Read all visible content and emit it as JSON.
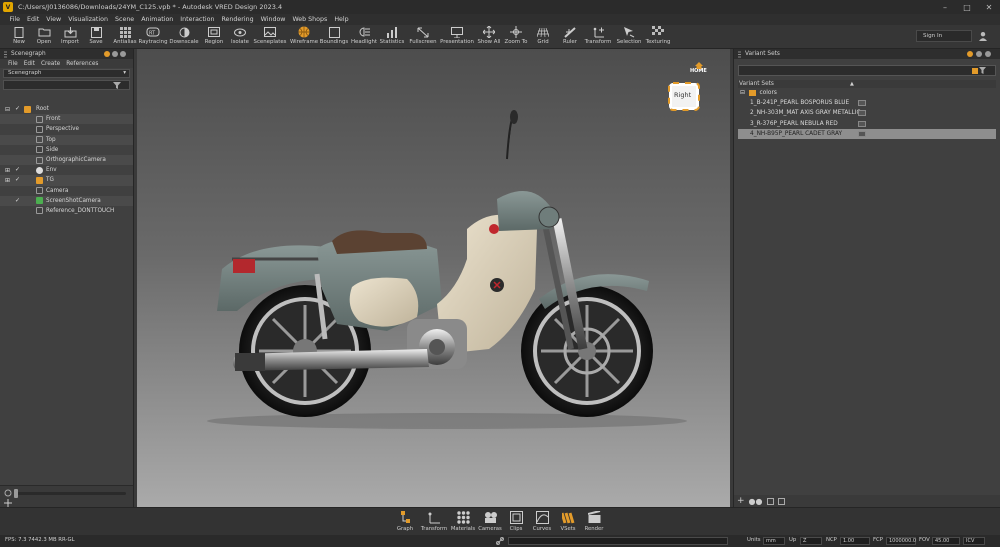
{
  "window": {
    "title": "C:/Users/J0136086/Downloads/24YM_C125.vpb * - Autodesk VRED Design 2023.4",
    "app_icon_letter": "V"
  },
  "menubar": [
    "File",
    "Edit",
    "View",
    "Visualization",
    "Scene",
    "Animation",
    "Interaction",
    "Rendering",
    "Window",
    "Web Shops",
    "Help"
  ],
  "toolbar": {
    "tools": [
      "New",
      "Open",
      "Import",
      "Save",
      "Antialias",
      "Raytracing",
      "Downscale",
      "Region",
      "Isolate",
      "Sceneplates",
      "Wireframe",
      "Boundings",
      "Headlight",
      "Statistics",
      "Fullscreen",
      "Presentation",
      "Show All",
      "Zoom To",
      "Grid",
      "Ruler",
      "Transform",
      "Selection",
      "Texturing"
    ],
    "signin": "Sign In"
  },
  "scenegraph": {
    "panel_title": "Scenegraph",
    "menu": [
      "File",
      "Edit",
      "Create",
      "References"
    ],
    "dropdown": "Scenegraph",
    "items": [
      "Root",
      "Front",
      "Perspective",
      "Top",
      "Side",
      "OrthographicCamera",
      "Env",
      "TG",
      "Camera",
      "ScreenShotCamera",
      "Reference_DONTTOUCH"
    ]
  },
  "viewport": {
    "viewcube_face": "Right",
    "home_label": "HOME"
  },
  "variant_sets": {
    "panel_title": "Variant Sets",
    "column_header": "Variant Sets",
    "group": "colors",
    "items": [
      "1_B-241P_PEARL BOSPORUS BLUE",
      "2_NH-303M_MAT AXIS GRAY METALLIC",
      "3_R-376P_PEARL NEBULA RED",
      "4_NH-B95P_PEARL CADET GRAY"
    ],
    "selected_index": 3
  },
  "modules": [
    "Graph",
    "Transform",
    "Materials",
    "Cameras",
    "Clips",
    "Curves",
    "VSets",
    "Render"
  ],
  "statusbar": {
    "fps": "FPS: 7.3  7442.3 MB  RR-GL",
    "units_label": "Units",
    "units_value": "mm",
    "up_label": "Up",
    "up_value": "Z",
    "ncp_label": "NCP",
    "ncp_value": "1.00",
    "fcp_label": "FCP",
    "fcp_value": "1000000.0",
    "fov_label": "FOV",
    "fov_value": "45.00",
    "mode_value": "ICV"
  },
  "colors": {
    "accent": "#e39b2a",
    "body_paint": "#6f7d7b",
    "cream_panel": "#d6cbb3",
    "seat_brown": "#5b4232"
  }
}
